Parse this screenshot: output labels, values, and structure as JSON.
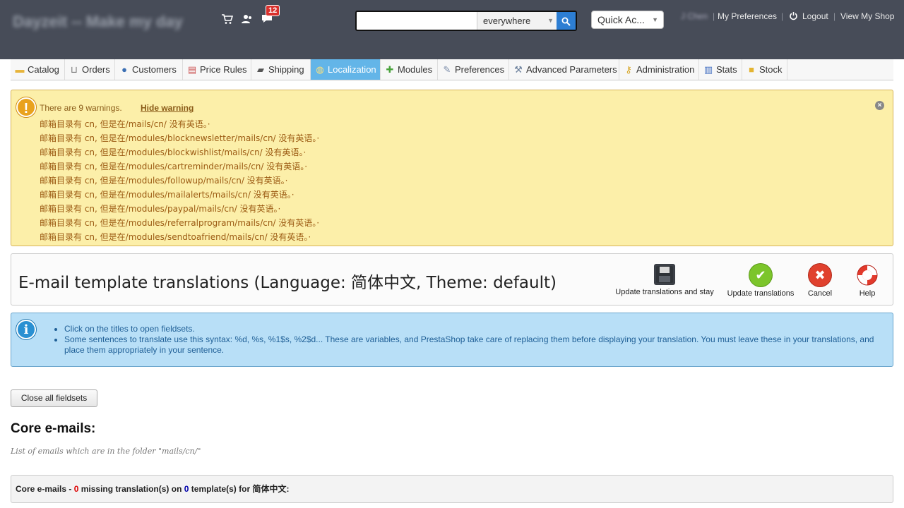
{
  "header": {
    "shop_name": "Dayzeit -- Make my day",
    "notifications_count": "12",
    "search": {
      "value": "",
      "scope": "everywhere"
    },
    "quick_access": "Quick Ac...",
    "user_name": "J Chen",
    "links": {
      "preferences": "My Preferences",
      "logout": "Logout",
      "view_shop": "View My Shop"
    }
  },
  "nav": {
    "tabs": [
      {
        "label": "Catalog",
        "icon": "folder-icon"
      },
      {
        "label": "Orders",
        "icon": "cart-icon"
      },
      {
        "label": "Customers",
        "icon": "user-icon"
      },
      {
        "label": "Price Rules",
        "icon": "price-rules-icon"
      },
      {
        "label": "Shipping",
        "icon": "truck-icon"
      },
      {
        "label": "Localization",
        "icon": "globe-icon",
        "active": true
      },
      {
        "label": "Modules",
        "icon": "puzzle-icon"
      },
      {
        "label": "Preferences",
        "icon": "preferences-icon"
      },
      {
        "label": "Advanced Parameters",
        "icon": "wrench-icon"
      },
      {
        "label": "Administration",
        "icon": "key-icon"
      },
      {
        "label": "Stats",
        "icon": "bar-chart-icon"
      },
      {
        "label": "Stock",
        "icon": "box-icon"
      }
    ]
  },
  "warning": {
    "title": "There are 9 warnings.",
    "hide_label": "Hide warning",
    "items": [
      "邮箱目录有 cn, 但是在/mails/cn/ 没有英语。·",
      "邮箱目录有 cn, 但是在/modules/blocknewsletter/mails/cn/ 没有英语。·",
      "邮箱目录有 cn, 但是在/modules/blockwishlist/mails/cn/ 没有英语。·",
      "邮箱目录有 cn, 但是在/modules/cartreminder/mails/cn/ 没有英语。·",
      "邮箱目录有 cn, 但是在/modules/followup/mails/cn/ 没有英语。·",
      "邮箱目录有 cn, 但是在/modules/mailalerts/mails/cn/ 没有英语。·",
      "邮箱目录有 cn, 但是在/modules/paypal/mails/cn/ 没有英语。·",
      "邮箱目录有 cn, 但是在/modules/referralprogram/mails/cn/ 没有英语。·",
      "邮箱目录有 cn, 但是在/modules/sendtoafriend/mails/cn/ 没有英语。·"
    ]
  },
  "toolbar": {
    "title": "E-mail template translations (Language: 简体中文, Theme: default)",
    "buttons": {
      "update_stay": "Update translations and stay",
      "update": "Update translations",
      "cancel": "Cancel",
      "help": "Help"
    }
  },
  "info": {
    "items": [
      "Click on the titles to open fieldsets.",
      "Some sentences to translate use this syntax: %d, %s, %1$s, %2$d... These are variables, and PrestaShop take care of replacing them before displaying your translation. You must leave these in your translations, and place them appropriately in your sentence."
    ]
  },
  "main": {
    "close_fieldsets": "Close all fieldsets",
    "section_title": "Core e-mails:",
    "section_subtitle": "List of emails which are in the folder \"mails/cn/\"",
    "fieldset": {
      "prefix": "Core e-mails - ",
      "missing_count": "0",
      "mid": " missing translation(s) on ",
      "template_count": "0",
      "suffix": " template(s) for 简体中文:"
    }
  },
  "colors": {
    "header_bg": "#474c58",
    "active_tab": "#63b5e8",
    "warning_bg": "#fcefa9",
    "info_bg": "#b8dff7",
    "search_btn": "#2d7ed3"
  }
}
